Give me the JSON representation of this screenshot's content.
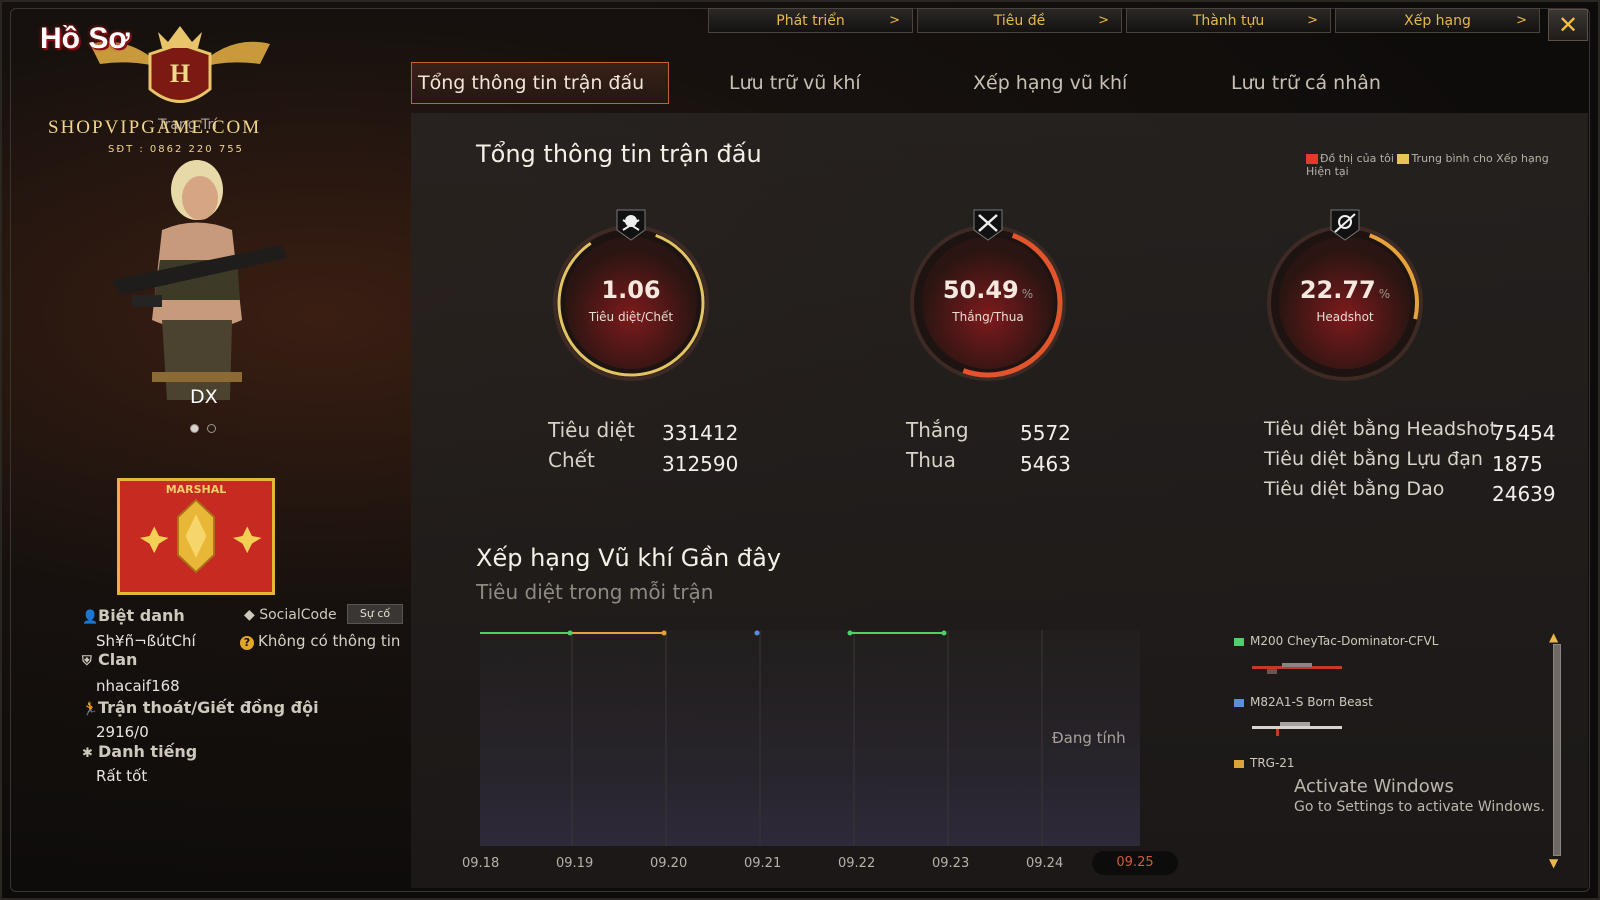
{
  "topnav": [
    {
      "label": "Phát triển"
    },
    {
      "label": "Tiêu đề"
    },
    {
      "label": "Thành tựu"
    },
    {
      "label": "Xếp hạng"
    }
  ],
  "logo": {
    "title": "Hồ Sơ",
    "site": "SHOPVIPGAME.COM",
    "phone": "SĐT : 0862 220 755",
    "under_text": "Trang Trí"
  },
  "character": {
    "name": "DX"
  },
  "rank": {
    "label": "MARSHAL"
  },
  "profile": {
    "nickname_label": "Biệt danh",
    "nickname_value": "Sh¥ñ¬ßútChí",
    "socialcode_label": "SocialCode",
    "su_co_button": "Sự cố",
    "no_info": "Không có thông tin",
    "clan_label": "Clan",
    "clan_value": "nhacaif168",
    "escape_label": "Trận thoát/Giết đồng đội",
    "escape_value": "2916/0",
    "reputation_label": "Danh tiếng",
    "reputation_value": "Rất tốt"
  },
  "tabs": [
    {
      "label": "Tổng thông tin trận đấu",
      "active": true
    },
    {
      "label": "Lưu trữ vũ khí",
      "active": false
    },
    {
      "label": "Xếp hạng vũ khí",
      "active": false
    },
    {
      "label": "Lưu trữ cá nhân",
      "active": false
    }
  ],
  "summary": {
    "title": "Tổng thông tin trận đấu",
    "legend_mine": "Đồ thị của tôi",
    "legend_avg": "Trung bình cho Xếp hạng Hiện tại",
    "gauges": [
      {
        "value": "1.06",
        "pct": "",
        "label": "Tiêu diệt/Chết",
        "icon": "skull-icon",
        "fill": 0.85
      },
      {
        "value": "50.49",
        "pct": "%",
        "label": "Thắng/Thua",
        "icon": "crossed-swords-icon",
        "fill": 0.5
      },
      {
        "value": "22.77",
        "pct": "%",
        "label": "Headshot",
        "icon": "headshot-icon",
        "fill": 0.23
      }
    ],
    "stats": {
      "kills_label": "Tiêu diệt",
      "kills_value": "331412",
      "deaths_label": "Chết",
      "deaths_value": "312590",
      "wins_label": "Thắng",
      "wins_value": "5572",
      "losses_label": "Thua",
      "losses_value": "5463",
      "hs_kills_label": "Tiêu diệt bằng Headshot",
      "hs_kills_value": "75454",
      "grenade_kills_label": "Tiêu diệt bằng Lựu đạn",
      "grenade_kills_value": "1875",
      "knife_kills_label": "Tiêu diệt bằng Dao",
      "knife_kills_value": "24639"
    }
  },
  "recent": {
    "title": "Xếp hạng Vũ khí Gần đây",
    "subtitle": "Tiêu diệt trong mỗi trận",
    "status": "Đang tính",
    "dates": [
      "09.18",
      "09.19",
      "09.20",
      "09.21",
      "09.22",
      "09.23",
      "09.24",
      "09.25"
    ],
    "active_date": "09.25",
    "weapons": [
      {
        "name": "M200 CheyTac-Dominator-CFVL",
        "color": "#4fd06a"
      },
      {
        "name": "M82A1-S Born Beast",
        "color": "#5a8fe0"
      },
      {
        "name": "TRG-21",
        "color": "#e0a23a"
      }
    ]
  },
  "windows": {
    "line1": "Activate Windows",
    "line2": "Go to Settings to activate Windows."
  }
}
